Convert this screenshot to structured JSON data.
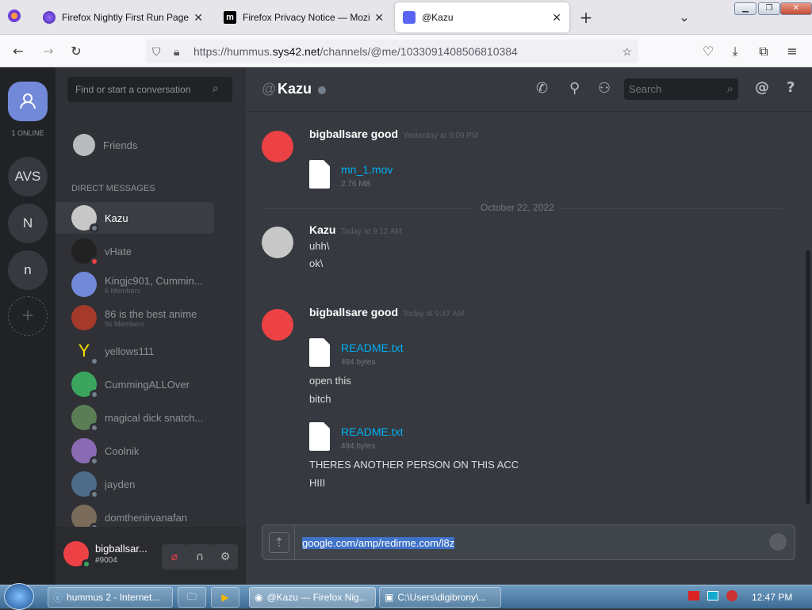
{
  "tabs": [
    {
      "label": "Firefox Nightly First Run Page",
      "color": "#5b3fd8"
    },
    {
      "label": "Firefox Privacy Notice — Mozilla",
      "color": "#000000"
    },
    {
      "label": "@Kazu",
      "color": "#5865f2"
    }
  ],
  "url": {
    "prefix": "https://hummus.",
    "domain": "sys42.net",
    "path": "/channels/@me/1033091408506810384"
  },
  "guilds": {
    "online": "1 ONLINE",
    "items": [
      "AVS",
      "N",
      "n"
    ]
  },
  "dm_panel": {
    "search_placeholder": "Find or start a conversation",
    "friends": "Friends",
    "header": "DIRECT MESSAGES",
    "items": [
      {
        "name": "Kazu",
        "sub": ""
      },
      {
        "name": "vHate",
        "sub": ""
      },
      {
        "name": "Kingjc901, Cummin...",
        "sub": "6 Members"
      },
      {
        "name": "86 is the best anime",
        "sub": "9s Members"
      },
      {
        "name": "yellows111",
        "sub": ""
      },
      {
        "name": "CummingALLOver",
        "sub": ""
      },
      {
        "name": "magical dick snatch...",
        "sub": ""
      },
      {
        "name": "Coolnik",
        "sub": ""
      },
      {
        "name": "jayden",
        "sub": ""
      },
      {
        "name": "domthenirvanafan",
        "sub": ""
      }
    ]
  },
  "user_panel": {
    "name": "bigballsar...",
    "tag": "#9004"
  },
  "topbar": {
    "at": "@",
    "channel": "Kazu",
    "search": "Search",
    "help": "?"
  },
  "messages": {
    "m1": {
      "author": "bigballsare good",
      "time": "Yesterday at 9:09 PM",
      "file": "mn_1.mov",
      "size": "2.76 MB"
    },
    "date": "October 22, 2022",
    "m2": {
      "author": "Kazu",
      "time": "Today at 9:12 AM",
      "lines": [
        "uhh\\",
        "ok\\"
      ]
    },
    "m3": {
      "author": "bigballsare good",
      "time": "Today at 9:47 AM",
      "file1": "README.txt",
      "size1": "494 bytes",
      "lines": [
        "open this",
        "bitch"
      ],
      "file2": "README.txt",
      "size2": "494 bytes",
      "lines2": [
        "THERES ANOTHER PERSON ON THIS ACC",
        "HIII"
      ]
    }
  },
  "composer": {
    "value": "google.com/amp/redirme.com/l8z"
  },
  "taskbar": {
    "items": [
      "hummus 2 - Internet...",
      "@Kazu — Firefox Nig...",
      "C:\\Users\\digibrony\\..."
    ],
    "clock": "12:47 PM"
  }
}
